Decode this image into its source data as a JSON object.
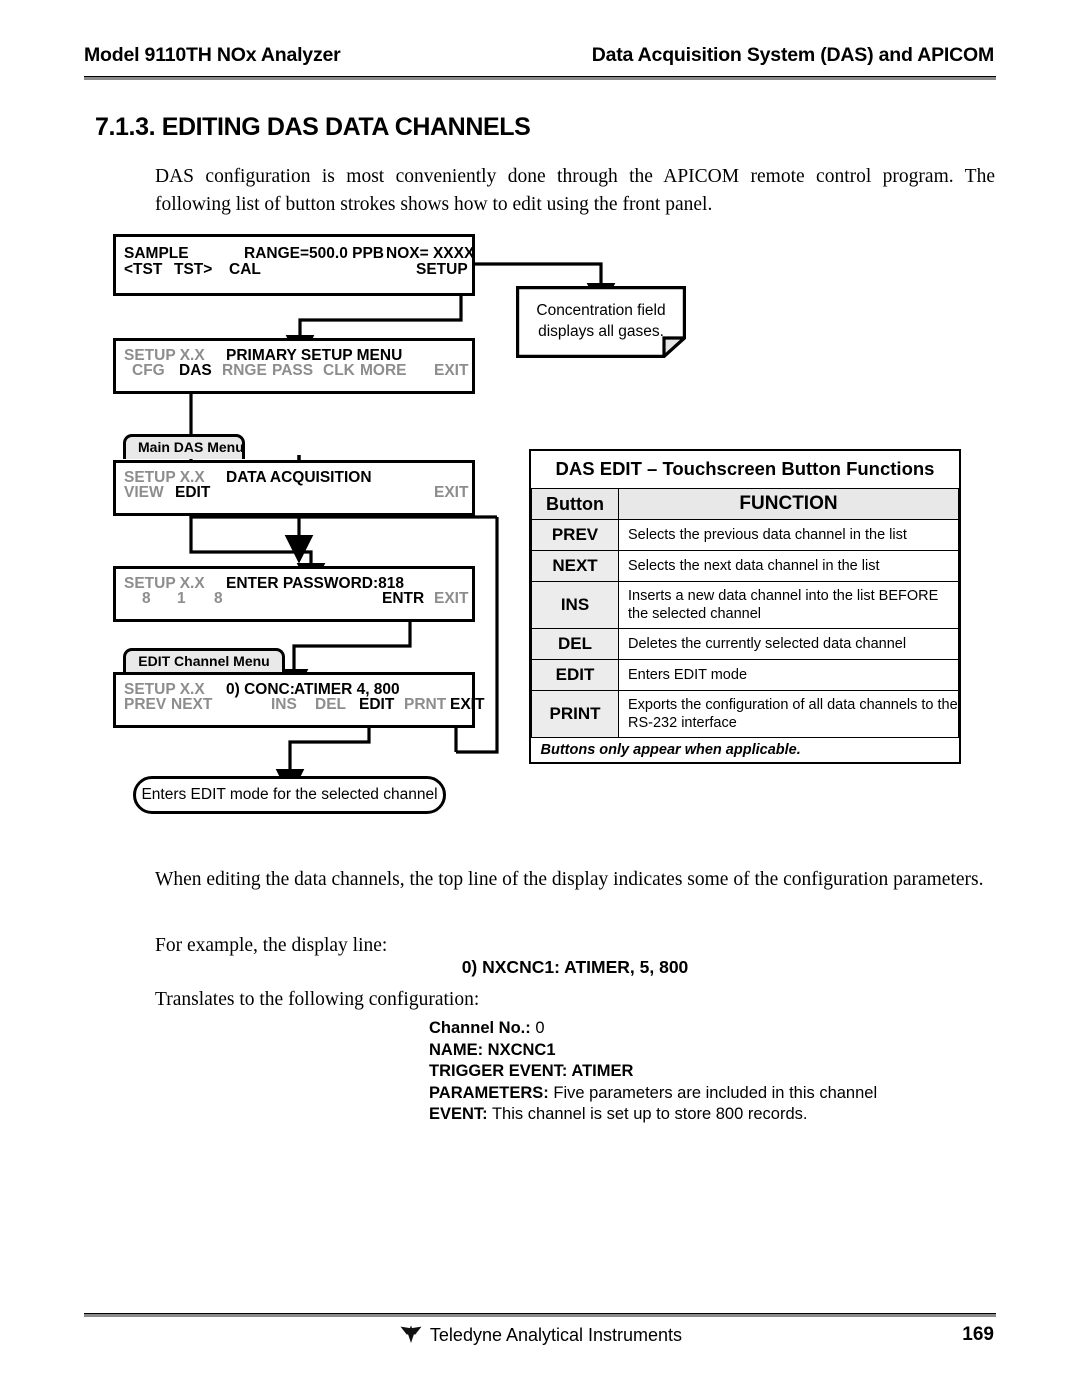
{
  "header": {
    "left": "Model 9110TH NOx Analyzer",
    "right": "Data Acquisition System (DAS) and APICOM"
  },
  "section": {
    "title": "7.1.3. EDITING DAS DATA CHANNELS",
    "intro": "DAS configuration is most conveniently done through the APICOM remote control program.  The following list of button strokes shows how to edit using the front panel."
  },
  "diagram": {
    "sample_screen": {
      "tab": "",
      "top": {
        "status": "SAMPLE",
        "range": "RANGE=500.0 PPB",
        "conc": "NOX= XXXX"
      },
      "bottom": {
        "prev_test": "<TST",
        "next_test": "TST>",
        "cal": "CAL",
        "setup": "SETUP"
      }
    },
    "note": {
      "line1": "Concentration field",
      "line2": "displays all gases."
    },
    "primary_setup": {
      "top": {
        "setup_label": "SETUP X.X",
        "menu_title": "PRIMARY SETUP MENU"
      },
      "buttons": [
        "CFG",
        "DAS",
        "RNGE",
        "PASS",
        "CLK",
        "MORE",
        "EXIT"
      ],
      "highlighted": "DAS"
    },
    "main_das": {
      "tab": "Main DAS Menu",
      "top": {
        "setup_label": "SETUP X.X",
        "menu_title": "DATA ACQUISITION"
      },
      "buttons": [
        "VIEW",
        "EDIT",
        "EXIT"
      ],
      "highlighted": "EDIT"
    },
    "password": {
      "top": {
        "setup_label": "SETUP X.X",
        "menu_title": "ENTER PASSWORD:818"
      },
      "digits": [
        "8",
        "1",
        "8"
      ],
      "buttons": [
        "ENTR",
        "EXIT"
      ],
      "highlighted": "ENTR"
    },
    "edit_channel": {
      "tab": "EDIT Channel Menu",
      "top": {
        "setup_label": "SETUP X.X",
        "channel": "0) CONC:",
        "config": "ATIMER 4, 800"
      },
      "buttons": [
        "PREV",
        "NEXT",
        "INS",
        "DEL",
        "EDIT",
        "PRNT",
        "EXIT"
      ],
      "highlighted": [
        "EDIT",
        "EXIT"
      ]
    },
    "result_capsule": "Enters EDIT mode for the selected channel"
  },
  "fn_table": {
    "title": "DAS EDIT – Touchscreen Button Functions",
    "col_button": "Button",
    "col_function": "FUNCTION",
    "rows": [
      {
        "button": "PREV",
        "function": "Selects the previous data channel in the list"
      },
      {
        "button": "NEXT",
        "function": "Selects the next data channel in the list"
      },
      {
        "button": "INS",
        "function": "Inserts a new data channel into the list BEFORE the selected channel"
      },
      {
        "button": "DEL",
        "function": "Deletes the currently selected data channel"
      },
      {
        "button": "EDIT",
        "function": "Enters EDIT mode"
      },
      {
        "button": "PRINT",
        "function": "Exports the configuration of all data channels to the RS-232 interface"
      }
    ],
    "footnote": "Buttons only appear when applicable."
  },
  "body": {
    "when_editing": "When editing the data channels, the top line of the display indicates some of the configuration parameters.",
    "for_example": "For example, the display line:",
    "display_line": "0) NXCNC1: ATIMER, 5, 800",
    "translates": "Translates to the following configuration:",
    "config": [
      {
        "label": "Channel No.:",
        "value": " 0"
      },
      {
        "label": "NAME: NXCNC1",
        "value": ""
      },
      {
        "label": "TRIGGER EVENT: ATIMER",
        "value": ""
      },
      {
        "label": "PARAMETERS:",
        "value": " Five parameters are included in this channel"
      },
      {
        "label": "EVENT:",
        "value": " This channel is set up to store 800 records."
      }
    ]
  },
  "footer": {
    "company": "Teledyne Analytical Instruments",
    "page": "169"
  }
}
